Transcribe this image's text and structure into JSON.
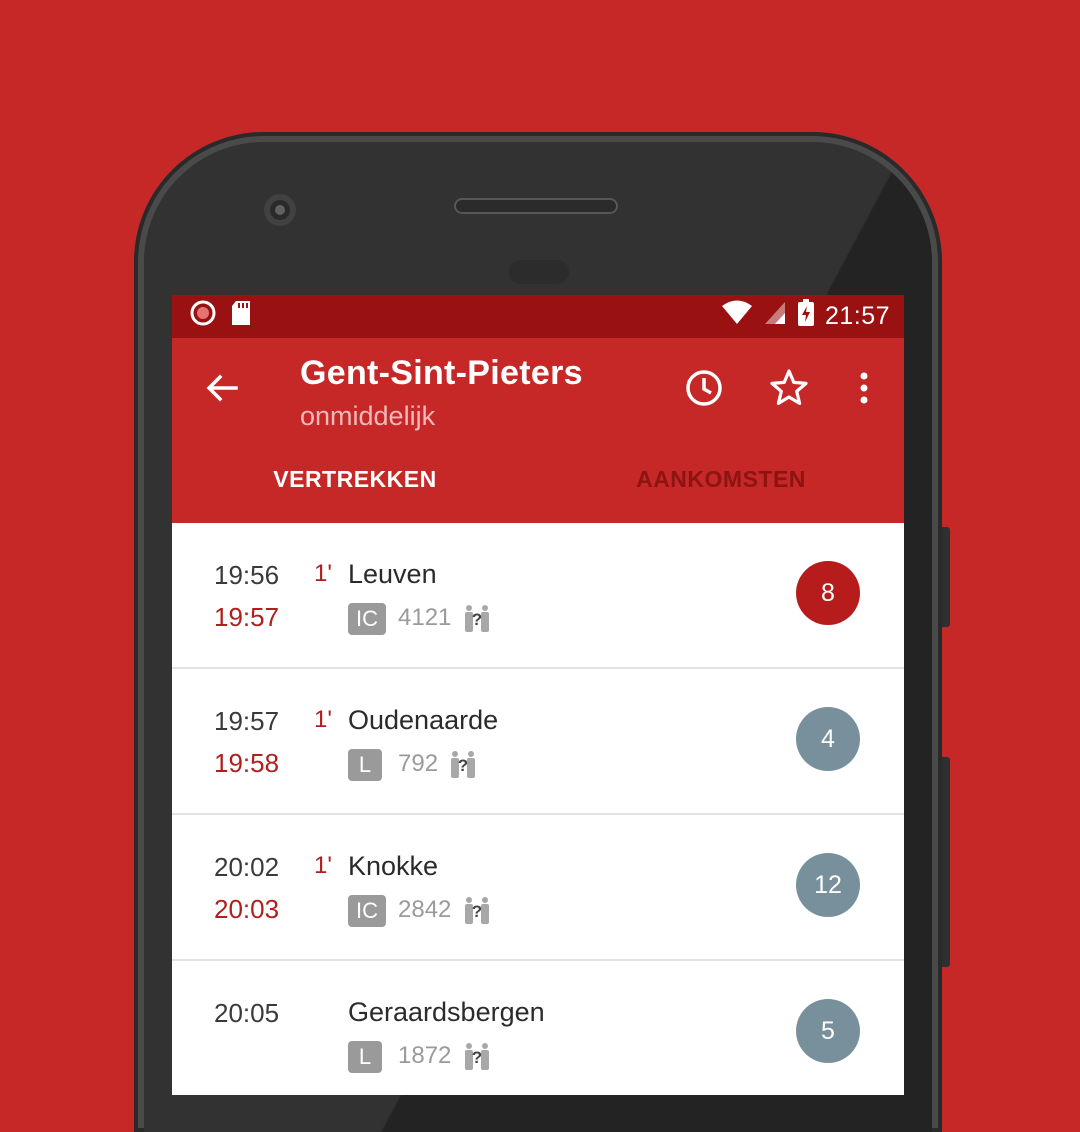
{
  "status_bar": {
    "time": "21:57"
  },
  "appbar": {
    "title": "Gent-Sint-Pieters",
    "subtitle": "onmiddelijk",
    "icons": [
      "back-arrow-icon",
      "clock-icon",
      "star-icon",
      "more-vert-icon"
    ]
  },
  "tabs": [
    {
      "label": "VERTREKKEN",
      "active": true
    },
    {
      "label": "AANKOMSTEN",
      "active": false
    }
  ],
  "departures": [
    {
      "scheduled": "19:56",
      "actual": "19:57",
      "delay": "1'",
      "destination": "Leuven",
      "type": "IC",
      "number": "4121",
      "platform": "8",
      "platform_changed": true
    },
    {
      "scheduled": "19:57",
      "actual": "19:58",
      "delay": "1'",
      "destination": "Oudenaarde",
      "type": "L",
      "number": "792",
      "platform": "4",
      "platform_changed": false
    },
    {
      "scheduled": "20:02",
      "actual": "20:03",
      "delay": "1'",
      "destination": "Knokke",
      "type": "IC",
      "number": "2842",
      "platform": "12",
      "platform_changed": false
    },
    {
      "scheduled": "20:05",
      "actual": "",
      "delay": "",
      "destination": "Geraardsbergen",
      "type": "L",
      "number": "1872",
      "platform": "5",
      "platform_changed": false
    }
  ],
  "colors": {
    "background": "#c62727",
    "status_bar": "#9a1111",
    "delay_red": "#b01e1e",
    "platform_changed": "#b71c1c",
    "platform_normal": "#78909c"
  }
}
